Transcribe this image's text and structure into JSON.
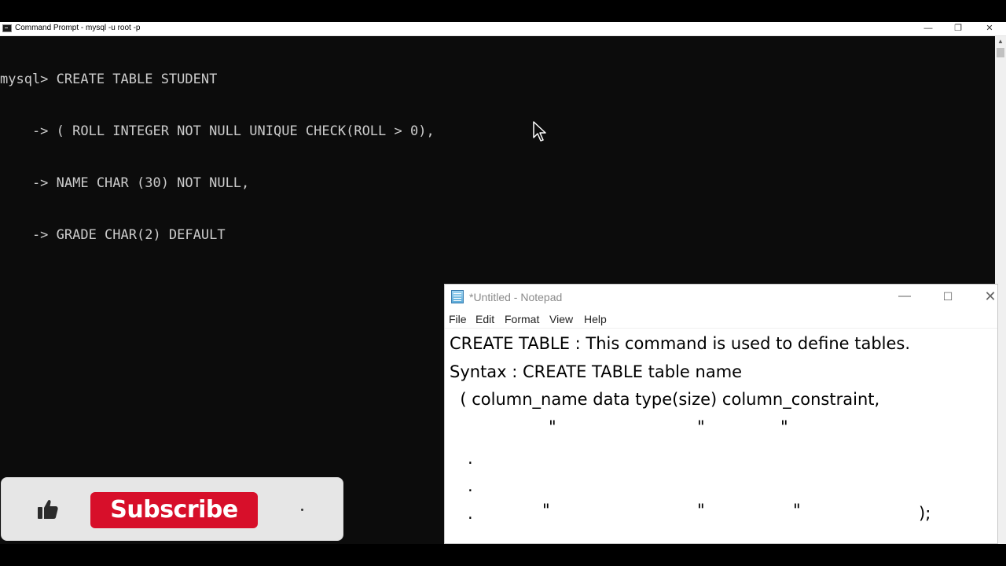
{
  "cmd": {
    "title": "Command Prompt - mysql  -u root -p",
    "controls": {
      "minimize": "—",
      "maximize": "❐",
      "close": "✕"
    },
    "lines": [
      "mysql> CREATE TABLE STUDENT",
      "    -> ( ROLL INTEGER NOT NULL UNIQUE CHECK(ROLL > 0),",
      "    -> NAME CHAR (30) NOT NULL,",
      "    -> GRADE CHAR(2) DEFAULT"
    ],
    "scroll_up": "▲"
  },
  "notepad": {
    "title": "*Untitled - Notepad",
    "controls": {
      "minimize": "—",
      "maximize": "☐",
      "close": "✕"
    },
    "menu": [
      "File",
      "Edit",
      "Format",
      "View",
      "Help"
    ],
    "lines": [
      "CREATE TABLE : This command is used to define tables.",
      "Syntax : CREATE TABLE table name",
      "  ( column_name data type(size) column_constraint,"
    ],
    "marks": {
      "quote": "\"",
      "dot": ".",
      "end": ");"
    }
  },
  "overlay": {
    "subscribe_label": "Subscribe",
    "icons": {
      "like": "thumbs-up-icon",
      "bell": "bell-icon"
    },
    "colors": {
      "subscribe_bg": "#d70f2a"
    }
  }
}
